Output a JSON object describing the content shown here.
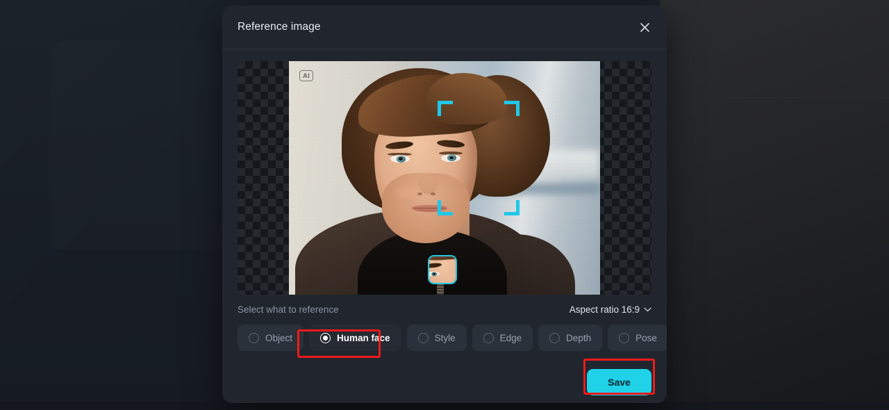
{
  "modal": {
    "title": "Reference image",
    "close_icon": "close-icon"
  },
  "image": {
    "ai_badge": "AI",
    "detection_brackets": 4,
    "thumbnail_label": "detected-face-thumbnail"
  },
  "options": {
    "label": "Select what to reference",
    "aspect_ratio": "Aspect ratio 16:9",
    "chevron_icon": "chevron-down-icon",
    "items": [
      {
        "label": "Object",
        "selected": false
      },
      {
        "label": "Human face",
        "selected": true
      },
      {
        "label": "Style",
        "selected": false
      },
      {
        "label": "Edge",
        "selected": false
      },
      {
        "label": "Depth",
        "selected": false
      },
      {
        "label": "Pose",
        "selected": false
      }
    ]
  },
  "footer": {
    "save_label": "Save"
  },
  "colors": {
    "accent": "#1fd2e8",
    "bracket": "#1fc8e8",
    "highlight": "#f01a1a",
    "modal_bg": "#21262e",
    "pill_bg": "#2b313a",
    "muted_text": "#8b93a1"
  }
}
